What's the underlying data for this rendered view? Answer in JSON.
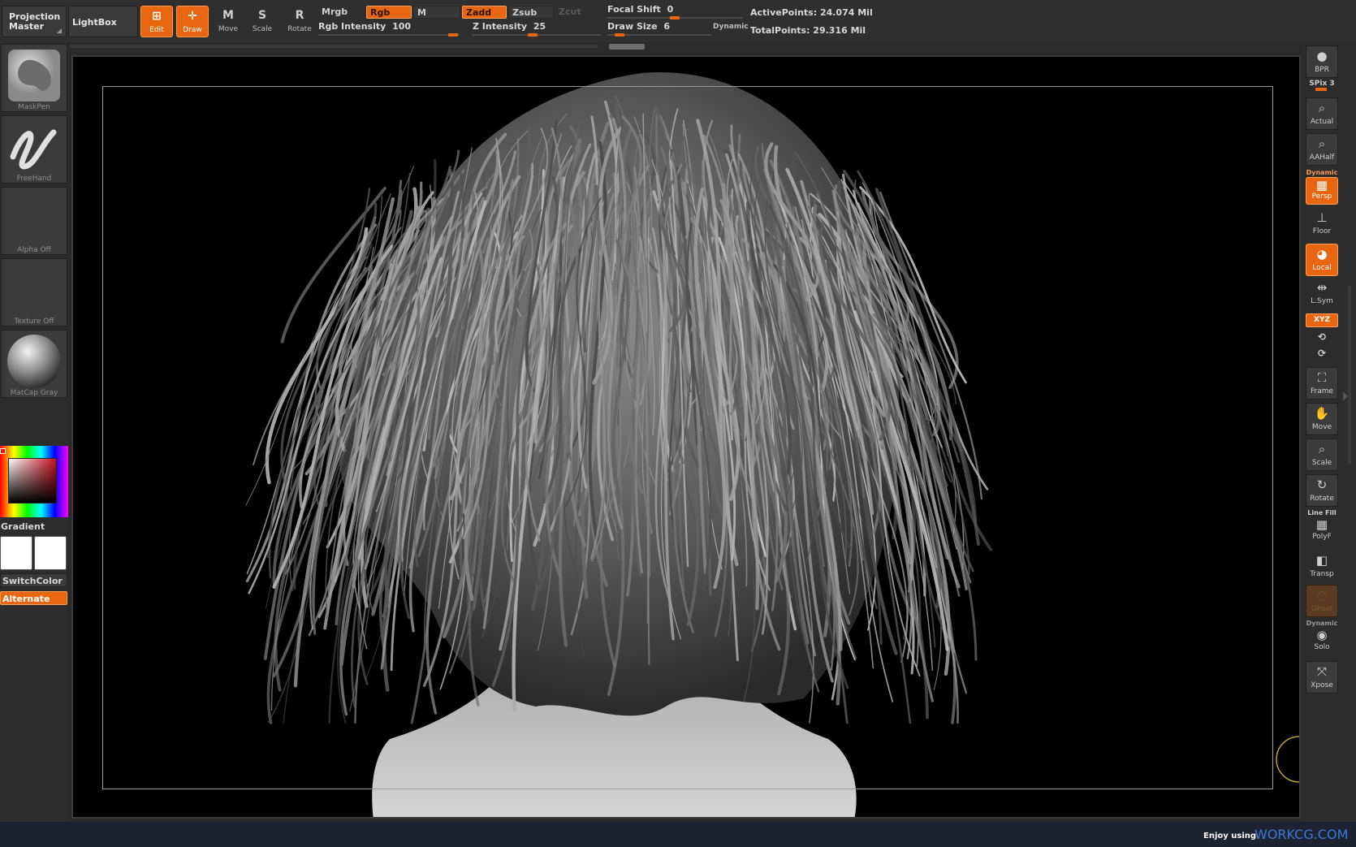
{
  "top": {
    "projection_master": "Projection Master",
    "lightbox": "LightBox",
    "tools": [
      {
        "label": "Edit",
        "glyph": "⊞",
        "active": true
      },
      {
        "label": "Draw",
        "glyph": "✛",
        "active": true
      },
      {
        "label": "Move",
        "glyph": "M",
        "active": false
      },
      {
        "label": "Scale",
        "glyph": "S",
        "active": false
      },
      {
        "label": "Rotate",
        "glyph": "R",
        "active": false
      }
    ],
    "mrgb": "Mrgb",
    "rgb": "Rgb",
    "m": "M",
    "zadd": "Zadd",
    "zsub": "Zsub",
    "zcut": "Zcut",
    "rgb_intensity_label": "Rgb Intensity",
    "rgb_intensity_value": "100",
    "z_intensity_label": "Z Intensity",
    "z_intensity_value": "25",
    "focal_shift_label": "Focal Shift",
    "focal_shift_value": "0",
    "draw_size_label": "Draw Size",
    "draw_size_value": "6",
    "dynamic": "Dynamic",
    "active_points": "ActivePoints: 24.074 Mil",
    "total_points": "TotalPoints: 29.316 Mil"
  },
  "left": {
    "brush": "MaskPen",
    "stroke": "FreeHand",
    "alpha": "Alpha Off",
    "texture": "Texture Off",
    "material": "MatCap Gray",
    "gradient": "Gradient",
    "switch_color": "SwitchColor",
    "alternate": "Alternate",
    "main_color": "#ffffff",
    "secondary_color": "#ffffff"
  },
  "right": {
    "bpr": "BPR",
    "spix": "SPix 3",
    "actual": "Actual",
    "aahalf": "AAHalf",
    "persp_dynamic": "Dynamic",
    "persp": "Persp",
    "floor": "Floor",
    "local": "Local",
    "lsym": "L.Sym",
    "xyz": "XYZ",
    "frame": "Frame",
    "move": "Move",
    "scale": "Scale",
    "rotate": "Rotate",
    "line_fill": "Line Fill",
    "polyf": "PolyF",
    "transp": "Transp",
    "ghost": "Ghost",
    "solo_dynamic": "Dynamic",
    "solo": "Solo",
    "xpose": "Xpose"
  },
  "footer": {
    "enjoy": "Enjoy using",
    "site": "WORKCG.COM"
  },
  "colors": {
    "accent": "#e8660f",
    "canvas": "#000000",
    "panel": "#2f2f2f"
  }
}
